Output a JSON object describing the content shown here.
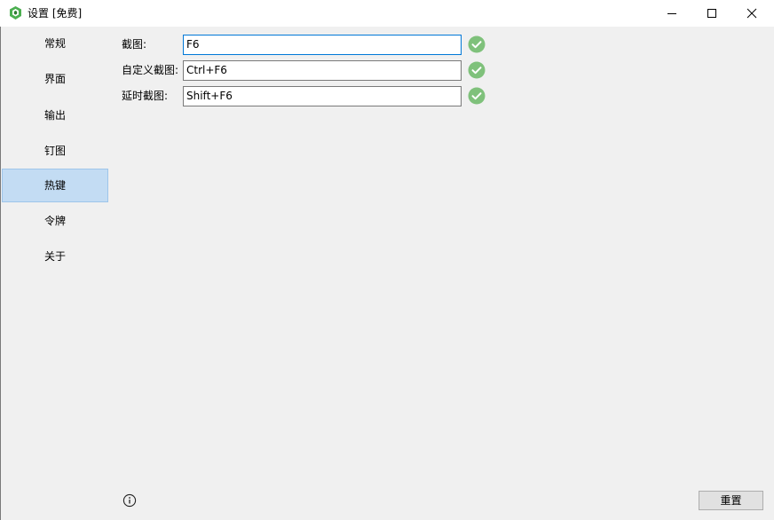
{
  "window": {
    "title": "设置 [免费]",
    "icon": "app-logo-icon"
  },
  "sidebar": {
    "items": [
      {
        "label": "常规",
        "selected": false
      },
      {
        "label": "界面",
        "selected": false
      },
      {
        "label": "输出",
        "selected": false
      },
      {
        "label": "钉图",
        "selected": false
      },
      {
        "label": "热键",
        "selected": true
      },
      {
        "label": "令牌",
        "selected": false
      },
      {
        "label": "关于",
        "selected": false
      }
    ]
  },
  "hotkeys": {
    "rows": [
      {
        "label": "截图:",
        "value": "F6",
        "status": "valid"
      },
      {
        "label": "自定义截图:",
        "value": "Ctrl+F6",
        "status": "valid"
      },
      {
        "label": "延时截图:",
        "value": "Shift+F6",
        "status": "valid"
      }
    ]
  },
  "footer": {
    "reset_label": "重置",
    "info_icon": "info-icon"
  },
  "colors": {
    "selected_bg": "#c3dcf3",
    "check_green": "#7fc17b",
    "focus_border": "#0078d7"
  }
}
